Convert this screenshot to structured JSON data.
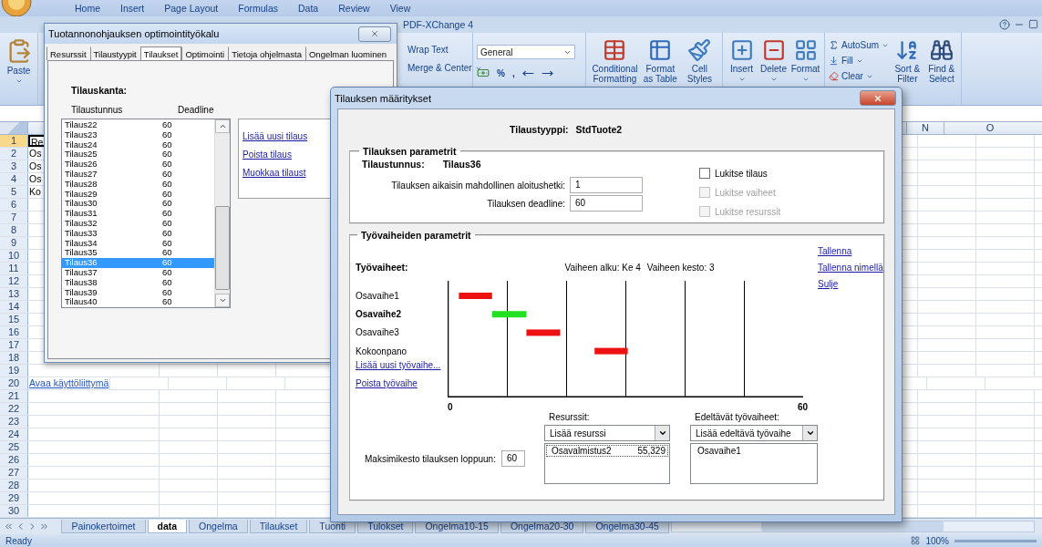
{
  "excel": {
    "ribbon_tabs": [
      "Home",
      "Insert",
      "Page Layout",
      "Formulas",
      "Data",
      "Review",
      "View"
    ],
    "addin_tab": "PDF-XChange 4",
    "paste": "Paste",
    "alignment": [
      "Wrap Text",
      "Merge & Center"
    ],
    "number_format": "General",
    "number_symbols": [
      "%",
      ","
    ],
    "styles": [
      "Conditional Formatting",
      "Format as Table",
      "Cell Styles"
    ],
    "cells": [
      "Insert",
      "Delete",
      "Format"
    ],
    "editing": {
      "autosum": "AutoSum",
      "fill": "Fill",
      "clear": "Clear",
      "sort": "Sort & Filter",
      "find": "Find & Select"
    },
    "column_headers": [
      "N",
      "O"
    ],
    "rows": [
      {
        "number": "1",
        "cell": "Re",
        "kind": "text",
        "selected": true
      },
      {
        "number": "2",
        "cell": "Os",
        "kind": "text",
        "selected": false
      },
      {
        "number": "3",
        "cell": "Os",
        "kind": "text",
        "selected": false
      },
      {
        "number": "4",
        "cell": "Os",
        "kind": "text",
        "selected": false
      },
      {
        "number": "5",
        "cell": "Ko",
        "kind": "text",
        "selected": false
      },
      {
        "number": "6",
        "selected": false
      },
      {
        "number": "7",
        "selected": false
      },
      {
        "number": "8",
        "selected": false
      },
      {
        "number": "9",
        "selected": false
      },
      {
        "number": "10",
        "selected": false
      },
      {
        "number": "11",
        "selected": false
      },
      {
        "number": "12",
        "selected": false
      },
      {
        "number": "13",
        "selected": false
      },
      {
        "number": "14",
        "selected": false
      },
      {
        "number": "15",
        "selected": false
      },
      {
        "number": "16",
        "selected": false
      },
      {
        "number": "17",
        "selected": false
      },
      {
        "number": "18",
        "selected": false
      },
      {
        "number": "19",
        "selected": false
      },
      {
        "number": "20",
        "cell": "Avaa käyttöliittymä",
        "kind": "link",
        "selected": false
      },
      {
        "number": "21",
        "selected": false
      },
      {
        "number": "22",
        "selected": false
      },
      {
        "number": "23",
        "selected": false
      },
      {
        "number": "24",
        "selected": false
      },
      {
        "number": "25",
        "selected": false
      },
      {
        "number": "26",
        "selected": false
      },
      {
        "number": "27",
        "selected": false
      },
      {
        "number": "28",
        "selected": false
      },
      {
        "number": "29",
        "selected": false
      },
      {
        "number": "30",
        "selected": false
      }
    ],
    "sheet_tabs": [
      {
        "label": "Painokertoimet",
        "selected": false
      },
      {
        "label": "data",
        "selected": true
      },
      {
        "label": "Ongelma",
        "selected": false
      },
      {
        "label": "Tilaukset",
        "selected": false
      },
      {
        "label": "Tuonti",
        "selected": false
      },
      {
        "label": "Tulokset",
        "selected": false
      },
      {
        "label": "Ongelma10-15",
        "selected": false
      },
      {
        "label": "Ongelma20-30",
        "selected": false
      },
      {
        "label": "Ongelma30-45",
        "selected": false
      }
    ],
    "status": "Ready",
    "zoom": "100%"
  },
  "tool_dialog": {
    "title": "Tuotannonohjauksen optimointityökalu",
    "tabs": [
      {
        "label": "Resurssit",
        "selected": false
      },
      {
        "label": "Tilaustyypit",
        "selected": false
      },
      {
        "label": "Tilaukset",
        "selected": true
      },
      {
        "label": "Optimointi",
        "selected": false
      },
      {
        "label": "Tietoja ohjelmasta",
        "selected": false
      },
      {
        "label": "Ongelman luominen",
        "selected": false
      }
    ],
    "heading": "Tilauskanta:",
    "columns": [
      "Tilaustunnus",
      "Deadline"
    ],
    "orders": [
      {
        "id": "Tilaus22",
        "deadline": "60",
        "selected": false
      },
      {
        "id": "Tilaus23",
        "deadline": "60",
        "selected": false
      },
      {
        "id": "Tilaus24",
        "deadline": "60",
        "selected": false
      },
      {
        "id": "Tilaus25",
        "deadline": "60",
        "selected": false
      },
      {
        "id": "Tilaus26",
        "deadline": "60",
        "selected": false
      },
      {
        "id": "Tilaus27",
        "deadline": "60",
        "selected": false
      },
      {
        "id": "Tilaus28",
        "deadline": "60",
        "selected": false
      },
      {
        "id": "Tilaus29",
        "deadline": "60",
        "selected": false
      },
      {
        "id": "Tilaus30",
        "deadline": "60",
        "selected": false
      },
      {
        "id": "Tilaus31",
        "deadline": "60",
        "selected": false
      },
      {
        "id": "Tilaus32",
        "deadline": "60",
        "selected": false
      },
      {
        "id": "Tilaus33",
        "deadline": "60",
        "selected": false
      },
      {
        "id": "Tilaus34",
        "deadline": "60",
        "selected": false
      },
      {
        "id": "Tilaus35",
        "deadline": "60",
        "selected": false
      },
      {
        "id": "Tilaus36",
        "deadline": "60",
        "selected": true
      },
      {
        "id": "Tilaus37",
        "deadline": "60",
        "selected": false
      },
      {
        "id": "Tilaus38",
        "deadline": "60",
        "selected": false
      },
      {
        "id": "Tilaus39",
        "deadline": "60",
        "selected": false
      },
      {
        "id": "Tilaus40",
        "deadline": "60",
        "selected": false
      }
    ],
    "links": [
      "Lisää uusi tilaus",
      "Poista tilaus",
      "Muokkaa tilaust"
    ]
  },
  "order_dialog": {
    "title": "Tilauksen määritykset",
    "type_label": "Tilaustyyppi:",
    "type_value": "StdTuote2",
    "order_params": {
      "legend": "Tilauksen parametrit",
      "id_label": "Tilaustunnus:",
      "id_value": "Tilaus36",
      "fields": [
        {
          "label": "Tilauksen aikaisin mahdollinen aloitushetki:",
          "value": "1"
        },
        {
          "label": "Tilauksen deadline:",
          "value": "60"
        }
      ],
      "locks": [
        {
          "label": "Lukitse tilaus",
          "checked": false,
          "disabled": false
        },
        {
          "label": "Lukitse vaiheet",
          "checked": false,
          "disabled": true
        },
        {
          "label": "Lukitse resurssit",
          "checked": false,
          "disabled": true
        }
      ]
    },
    "phase_params": {
      "legend": "Työvaiheiden parametrit",
      "heading": "Työvaiheet:",
      "phase_start": "Vaiheen alku: Ke 4",
      "phase_duration": "Vaiheen kesto: 3",
      "phases": [
        {
          "name": "Osavaihe1",
          "selected": false
        },
        {
          "name": "Osavaihe2",
          "selected": true
        },
        {
          "name": "Osavaihe3",
          "selected": false
        },
        {
          "name": "Kokoonpano",
          "selected": false
        }
      ],
      "phase_links": [
        "Lisää uusi työvaihe...",
        "Poista työvaihe"
      ],
      "axis_start": "0",
      "axis_end": "60",
      "actions": [
        "Tallenna",
        "Tallenna nimellä",
        "Sulje"
      ],
      "max_duration_label": "Maksimikesto tilauksen loppuun:",
      "max_duration": "60",
      "resources": {
        "label": "Resurssit:",
        "dropdown": "Lisää resurssi",
        "items": [
          {
            "name": "Osavalmistus2",
            "value": "55,329"
          }
        ]
      },
      "predecessors": {
        "label": "Edeltävät työvaiheet:",
        "dropdown": "Lisää edeltävä työvaihe",
        "items": [
          "Osavaihe1"
        ]
      }
    }
  }
}
